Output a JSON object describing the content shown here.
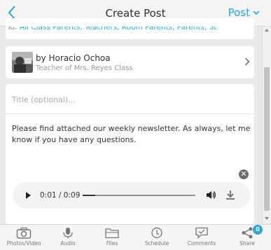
{
  "header": {
    "title": "Create Post",
    "post_label": "Post"
  },
  "recipients": {
    "label": "To:",
    "value": "All Class Parents, Teachers, Room Parents, Parents, Stu..."
  },
  "author": {
    "name": "by Horacio Ochoa",
    "subtitle": "Teacher of Mrs. Reyes Class"
  },
  "compose": {
    "title_placeholder": "Title (optional)...",
    "body": "Please find attached our weekly newsletter. As always, let me know if you have any questions."
  },
  "audio": {
    "time": "0:01 / 0:09",
    "progress": 0.11
  },
  "toolbar": {
    "photos": "Photos/Video",
    "audio": "Audio",
    "files": "Files",
    "schedule": "Schedule",
    "comments": "Comments",
    "share": "Share",
    "share_count": "0"
  },
  "colors": {
    "accent": "#2ba6de",
    "background": "#e9e9ea"
  }
}
